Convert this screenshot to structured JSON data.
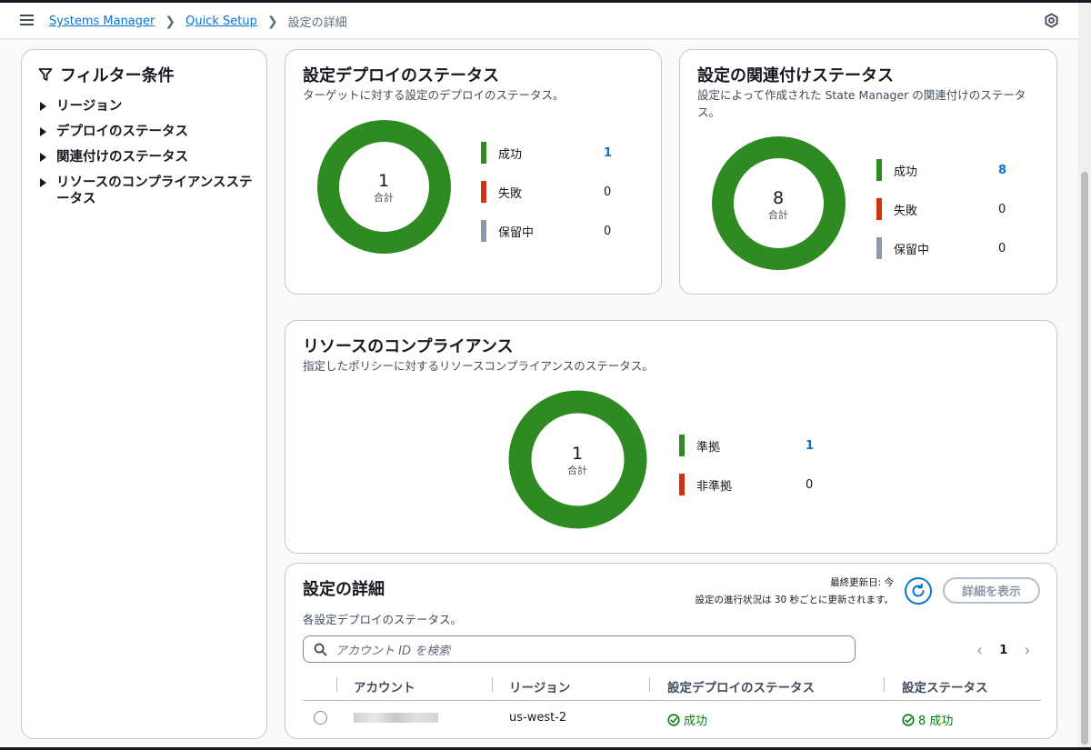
{
  "breadcrumb": {
    "items": [
      "Systems Manager",
      "Quick Setup"
    ],
    "current": "設定の詳細"
  },
  "filters": {
    "title": "フィルター条件",
    "items": [
      "リージョン",
      "デプロイのステータス",
      "関連付けのステータス",
      "リソースのコンプライアンスステータス"
    ]
  },
  "deploy_status": {
    "title": "設定デプロイのステータス",
    "subtitle": "ターゲットに対する設定のデプロイのステータス。",
    "total": "1",
    "total_label": "合計",
    "legend": [
      {
        "label": "成功",
        "value": "1"
      },
      {
        "label": "失敗",
        "value": "0"
      },
      {
        "label": "保留中",
        "value": "0"
      }
    ]
  },
  "association_status": {
    "title": "設定の関連付けステータス",
    "subtitle": "設定によって作成された State Manager の関連付けのステータス。",
    "total": "8",
    "total_label": "合計",
    "legend": [
      {
        "label": "成功",
        "value": "8"
      },
      {
        "label": "失敗",
        "value": "0"
      },
      {
        "label": "保留中",
        "value": "0"
      }
    ]
  },
  "compliance": {
    "title": "リソースのコンプライアンス",
    "subtitle": "指定したポリシーに対するリソースコンプライアンスのステータス。",
    "total": "1",
    "total_label": "合計",
    "legend": [
      {
        "label": "準拠",
        "value": "1"
      },
      {
        "label": "非準拠",
        "value": "0"
      }
    ]
  },
  "details": {
    "title": "設定の詳細",
    "subtitle": "各設定デプロイのステータス。",
    "last_updated": "最終更新日: 今",
    "update_note": "設定の進行状況は 30 秒ごとに更新されます。",
    "view_button": "詳細を表示",
    "search_placeholder": "アカウント ID を検索",
    "page": "1",
    "columns": [
      "アカウント",
      "リージョン",
      "設定デプロイのステータス",
      "設定ステータス"
    ],
    "rows": [
      {
        "region": "us-west-2",
        "deploy_status": "成功",
        "config_status": "8 成功"
      }
    ]
  },
  "colors": {
    "success": "#2e8b22",
    "failed": "#d13212",
    "pending": "#8d99a8",
    "link": "#0972d3"
  }
}
